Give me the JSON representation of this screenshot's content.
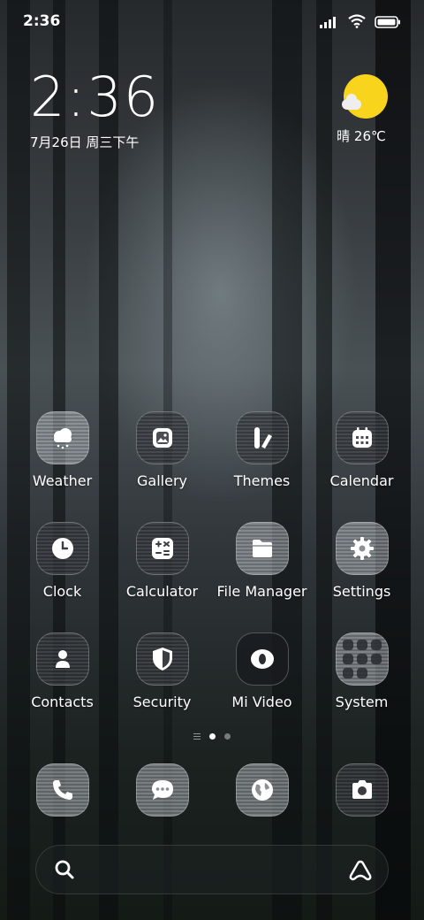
{
  "status_bar": {
    "time": "2:36",
    "icons": [
      "signal-icon",
      "wifi-icon",
      "battery-icon"
    ]
  },
  "clock_widget": {
    "time": "2:36",
    "date": "7月26日 周三下午"
  },
  "weather_widget": {
    "condition_icon": "sunny-icon",
    "text": "晴 26℃",
    "sun_color": "#f9d41c"
  },
  "apps": [
    {
      "label": "Weather",
      "icon": "weather-icon"
    },
    {
      "label": "Gallery",
      "icon": "gallery-icon"
    },
    {
      "label": "Themes",
      "icon": "themes-icon"
    },
    {
      "label": "Calendar",
      "icon": "calendar-icon"
    },
    {
      "label": "Clock",
      "icon": "clock-icon"
    },
    {
      "label": "Calculator",
      "icon": "calculator-icon"
    },
    {
      "label": "File Manager",
      "icon": "folder-icon"
    },
    {
      "label": "Settings",
      "icon": "gear-icon"
    },
    {
      "label": "Contacts",
      "icon": "contacts-icon"
    },
    {
      "label": "Security",
      "icon": "shield-icon"
    },
    {
      "label": "Mi Video",
      "icon": "video-icon"
    },
    {
      "label": "System",
      "icon": "folder-grid-icon"
    }
  ],
  "page_indicator": {
    "pages": 2,
    "active": 1
  },
  "dock": [
    {
      "icon": "phone-icon"
    },
    {
      "icon": "messages-icon"
    },
    {
      "icon": "browser-icon"
    },
    {
      "icon": "camera-icon"
    }
  ],
  "search_bar": {
    "left_icon": "search-icon",
    "right_icon": "assistant-icon"
  }
}
